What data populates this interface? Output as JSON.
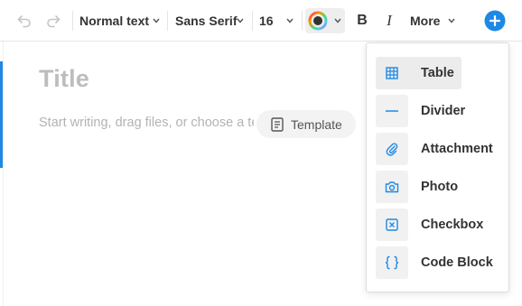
{
  "toolbar": {
    "undo_icon": "undo-icon",
    "redo_icon": "redo-icon",
    "text_style": "Normal text",
    "font_family": "Sans Serif",
    "font_size": "16",
    "text_color_icon": "color-wheel-icon",
    "bold_label": "B",
    "italic_label": "I",
    "more_label": "More",
    "insert_icon": "plus-circle-icon",
    "accent_color": "#1e88e5"
  },
  "editor": {
    "title_placeholder": "Title",
    "body_placeholder": "Start writing, drag files, or choose a template",
    "template_button": "Template"
  },
  "insert_menu": {
    "items": [
      {
        "label": "Table",
        "icon": "table-icon",
        "highlighted": true
      },
      {
        "label": "Divider",
        "icon": "divider-icon",
        "highlighted": false
      },
      {
        "label": "Attachment",
        "icon": "paperclip-icon",
        "highlighted": false
      },
      {
        "label": "Photo",
        "icon": "camera-icon",
        "highlighted": false
      },
      {
        "label": "Checkbox",
        "icon": "checkbox-icon",
        "highlighted": false
      },
      {
        "label": "Code Block",
        "icon": "code-braces-icon",
        "highlighted": false
      }
    ],
    "icon_color": "#1e88e5"
  }
}
